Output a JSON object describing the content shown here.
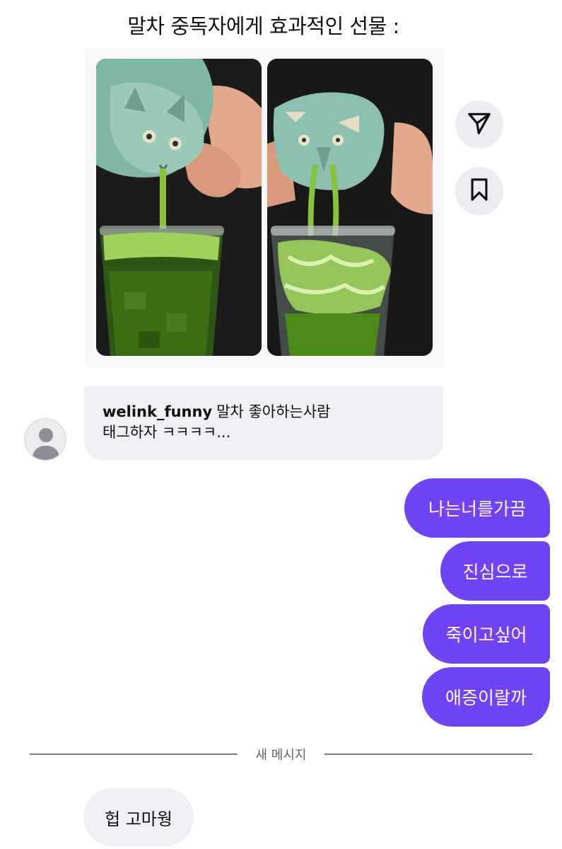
{
  "post": {
    "title": "말차 중독자에게 효과적인 선물 :",
    "images": [
      "matcha-pouring-cat-mug-photo",
      "matcha-pouring-cat-mug-over-ice-photo"
    ]
  },
  "actions": {
    "share_icon": "send-icon",
    "save_icon": "bookmark-icon"
  },
  "caption": {
    "username": "welink_funny",
    "text_line1": "말차 좋아하는사람",
    "text_line2": "태그하자 ㅋㅋㅋㅋ..."
  },
  "messages": {
    "outgoing": [
      "나는너를가끔",
      "진심으로",
      "죽이고싶어",
      "애증이랄까"
    ],
    "divider_label": "새 메시지",
    "incoming": [
      "헙 고마웡"
    ]
  },
  "colors": {
    "outgoing_bubble": "#7043f5",
    "incoming_bubble": "#efeff3",
    "icon_button_bg": "#ececf0"
  }
}
